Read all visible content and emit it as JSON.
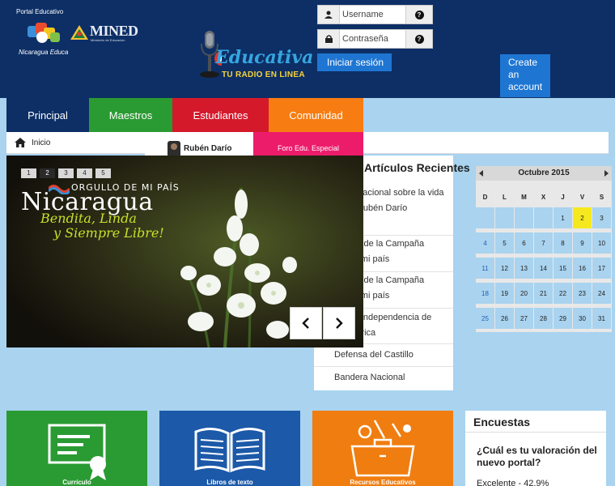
{
  "header": {
    "portal_small": "Portal Educativo",
    "portal_caption": "Nicaragua Educa",
    "mined_word": "MINED",
    "mined_sub": "Ministerio de Educación",
    "radio_brand": "Educativa",
    "radio_tag": "TU RADIO EN LINEA",
    "username_placeholder": "Username",
    "password_placeholder": "Contraseña",
    "login_label": "Iniciar sesión",
    "create_account_label": "Create an account",
    "colors": {
      "background": "#0d2f66",
      "button": "#1f76d2"
    }
  },
  "nav": {
    "items": [
      {
        "label": "Principal",
        "color": "#0d2f66"
      },
      {
        "label": "Maestros",
        "color": "#2a9a33"
      },
      {
        "label": "Estudiantes",
        "color": "#d4192b"
      },
      {
        "label": "Comunidad",
        "color": "#f77d12"
      }
    ]
  },
  "breadcrumb": {
    "home_label": "Inicio"
  },
  "submenu": {
    "ruben_label": "Rubén Darío",
    "foro_label": "Foro Edu. Especial"
  },
  "slider": {
    "dots": [
      "1",
      "2",
      "3",
      "4",
      "5"
    ],
    "active_dot": 2,
    "headline_small": "ORGULLO DE MI PAÍS",
    "headline_big": "Nicaragua",
    "line1": "Bendita, Linda",
    "line2": "y Siempre Libre!"
  },
  "recent": {
    "title": "Artículos Recientes",
    "items": [
      "Concurso nacional sobre la vida y obra de Rubén Darío",
      "Ganadores de la Campaña Orgullo de mi país",
      "Ganadores de la Campaña Orgullo de mi país",
      "Fiestas de Independencia de Centroamérica",
      "Defensa del Castillo",
      "Bandera Nacional"
    ]
  },
  "calendar": {
    "title": "Octubre 2015",
    "day_headers": [
      "D",
      "L",
      "M",
      "X",
      "J",
      "V",
      "S"
    ],
    "weeks": [
      [
        "",
        "",
        "",
        "",
        "1",
        "2",
        "3"
      ],
      [
        "4",
        "5",
        "6",
        "7",
        "8",
        "9",
        "10"
      ],
      [
        "11",
        "12",
        "13",
        "14",
        "15",
        "16",
        "17"
      ],
      [
        "18",
        "19",
        "20",
        "21",
        "22",
        "23",
        "24"
      ],
      [
        "25",
        "26",
        "27",
        "28",
        "29",
        "30",
        "31"
      ]
    ],
    "highlighted_day": "2"
  },
  "tiles": [
    {
      "label": "Currículo",
      "color": "#2a9a33",
      "icon": "certificate-icon"
    },
    {
      "label": "Libros de texto",
      "color": "#1c59a8",
      "icon": "open-book-icon"
    },
    {
      "label": "Recursos Educativos",
      "color": "#f07d0f",
      "icon": "toolbox-icon"
    }
  ],
  "encuestas": {
    "title": "Encuestas",
    "question": "¿Cuál es tu valoración del nuevo portal?",
    "result": "Excelente - 42.9%"
  }
}
